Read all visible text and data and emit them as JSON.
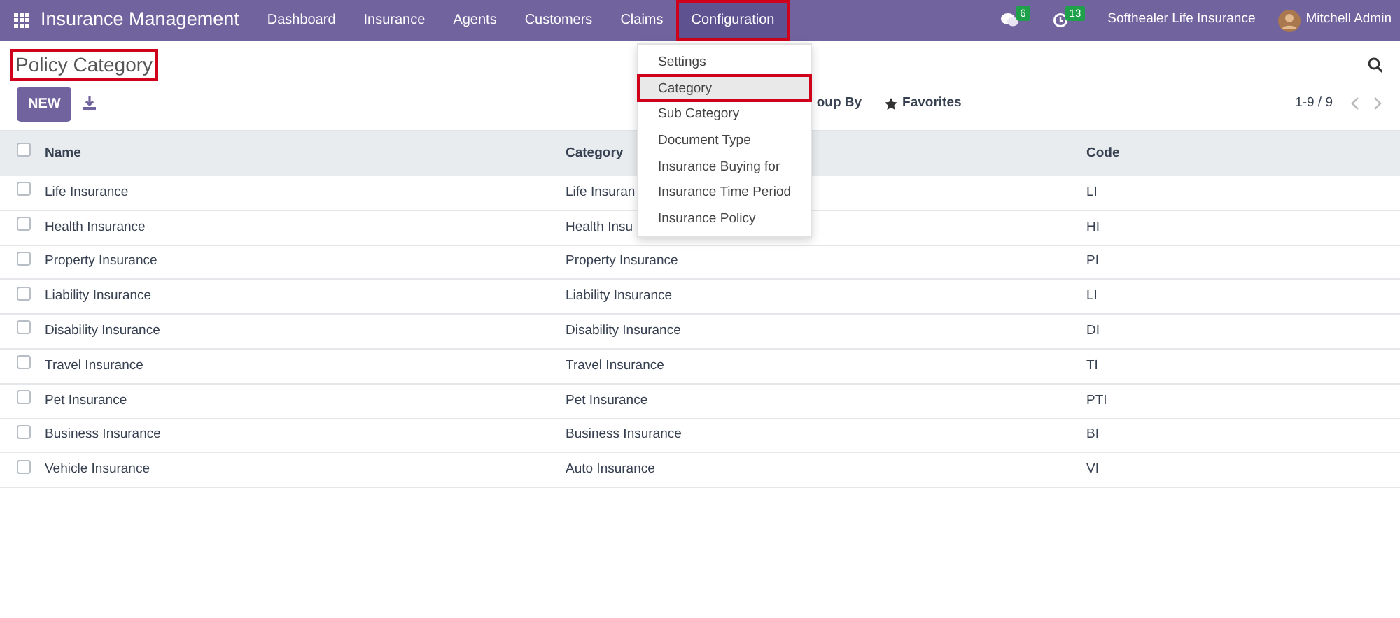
{
  "navbar": {
    "app_name": "Insurance Management",
    "menus": [
      {
        "label": "Dashboard",
        "selected": false,
        "highlighted": false
      },
      {
        "label": "Insurance",
        "selected": false,
        "highlighted": false
      },
      {
        "label": "Agents",
        "selected": false,
        "highlighted": false
      },
      {
        "label": "Customers",
        "selected": false,
        "highlighted": false
      },
      {
        "label": "Claims",
        "selected": false,
        "highlighted": false
      },
      {
        "label": "Configuration",
        "selected": true,
        "highlighted": true
      }
    ],
    "messages_count": "6",
    "activities_count": "13",
    "company": "Softhealer Life Insurance",
    "user": "Mitchell Admin"
  },
  "page": {
    "title": "Policy Category",
    "title_highlighted": true,
    "new_button": "NEW",
    "group_by": "oup By",
    "favorites": "Favorites",
    "pager": "1-9 / 9"
  },
  "dropdown": {
    "items": [
      {
        "label": "Settings",
        "selected": false,
        "highlighted": false
      },
      {
        "label": "Category",
        "selected": true,
        "highlighted": true
      },
      {
        "label": "Sub Category",
        "selected": false,
        "highlighted": false
      },
      {
        "label": "Document Type",
        "selected": false,
        "highlighted": false
      },
      {
        "label": "Insurance Buying for",
        "selected": false,
        "highlighted": false
      },
      {
        "label": "Insurance Time Period",
        "selected": false,
        "highlighted": false
      },
      {
        "label": "Insurance Policy",
        "selected": false,
        "highlighted": false
      }
    ]
  },
  "table": {
    "select_all_checked": false,
    "columns": [
      "Name",
      "Category",
      "Code"
    ],
    "rows": [
      {
        "checked": false,
        "cells": [
          "Life Insurance",
          "Life Insuran",
          "LI"
        ]
      },
      {
        "checked": false,
        "cells": [
          "Health Insurance",
          "Health Insu",
          "HI"
        ]
      },
      {
        "checked": false,
        "cells": [
          "Property Insurance",
          "Property Insurance",
          "PI"
        ]
      },
      {
        "checked": false,
        "cells": [
          "Liability Insurance",
          "Liability Insurance",
          "LI"
        ]
      },
      {
        "checked": false,
        "cells": [
          "Disability Insurance",
          "Disability Insurance",
          "DI"
        ]
      },
      {
        "checked": false,
        "cells": [
          "Travel Insurance",
          "Travel Insurance",
          "TI"
        ]
      },
      {
        "checked": false,
        "cells": [
          "Pet Insurance",
          "Pet Insurance",
          "PTI"
        ]
      },
      {
        "checked": false,
        "cells": [
          "Business Insurance",
          "Business Insurance",
          "BI"
        ]
      },
      {
        "checked": false,
        "cells": [
          "Vehicle Insurance",
          "Auto Insurance",
          "VI"
        ]
      }
    ]
  }
}
